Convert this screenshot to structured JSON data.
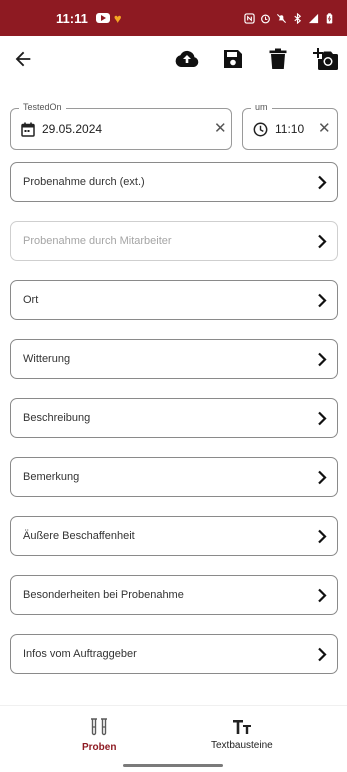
{
  "status_bar": {
    "time": "11:11",
    "icons": [
      "youtube-icon",
      "heart-icon",
      "nfc-icon",
      "alarm-icon",
      "mute-icon",
      "bluetooth-icon",
      "signal-icon",
      "battery-icon"
    ],
    "background": "#8e1a22"
  },
  "toolbar": {
    "actions": [
      "back-arrow-icon",
      "cloud-upload-icon",
      "save-icon",
      "delete-icon",
      "add-photo-icon"
    ]
  },
  "form": {
    "date": {
      "label": "TestedOn",
      "value": "29.05.2024"
    },
    "time": {
      "label": "um",
      "value": "11:10"
    }
  },
  "list_items": [
    {
      "label": "Probenahme durch (ext.)",
      "enabled": true
    },
    {
      "label": "Probenahme durch Mitarbeiter",
      "enabled": false
    },
    {
      "label": "Ort",
      "enabled": true
    },
    {
      "label": "Witterung",
      "enabled": true
    },
    {
      "label": "Beschreibung",
      "enabled": true
    },
    {
      "label": "Bemerkung",
      "enabled": true
    },
    {
      "label": "Äußere Beschaffenheit",
      "enabled": true
    },
    {
      "label": "Besonderheiten bei Probenahme",
      "enabled": true
    },
    {
      "label": "Infos vom Auftraggeber",
      "enabled": true
    }
  ],
  "bottom_nav": {
    "items": [
      {
        "label": "Proben",
        "icon": "test-tubes-icon",
        "active": true
      },
      {
        "label": "Textbausteine",
        "icon": "text-format-icon",
        "active": false
      }
    ],
    "accent": "#8e1a22"
  }
}
